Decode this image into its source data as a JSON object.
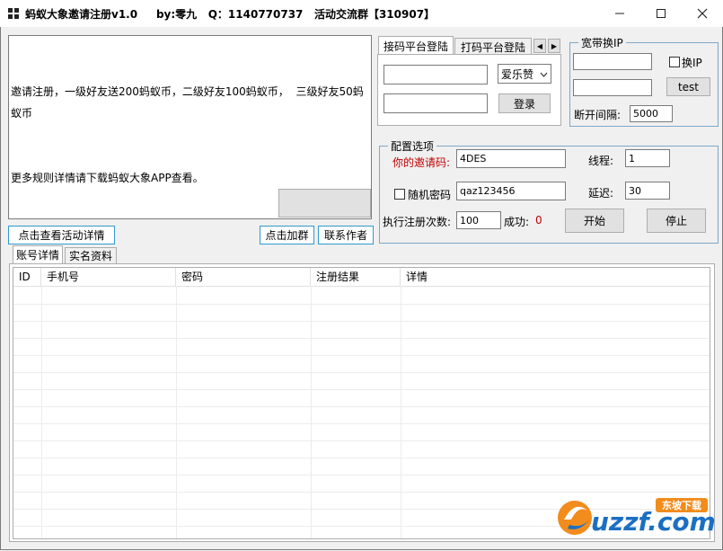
{
  "window": {
    "title": "蚂蚁大象邀请注册v1.0     by:零九   Q：1140770737   活动交流群【310907】",
    "min_icon": "minimize-icon",
    "max_icon": "maximize-icon",
    "close_icon": "close-icon"
  },
  "notice": {
    "line1": "邀请注册，一级好友送200蚂蚁币，二级好友100蚂蚁币，  三级好友50蚂蚁币",
    "line2": "更多规则详情请下载蚂蚁大象APP查看。"
  },
  "links": {
    "activity_details": "点击查看活动详情",
    "join_group": "点击加群",
    "contact_author": "联系作者"
  },
  "platform_tabs": {
    "tab1": "接码平台登陆",
    "tab2": "打码平台登陆",
    "platform_selected": "爱乐赞",
    "login_button": "登录",
    "input1_value": "",
    "input2_value": ""
  },
  "broadband": {
    "group_title": "宽带换IP",
    "input1_value": "",
    "input2_value": "",
    "switch_ip_label": "换IP",
    "test_button": "test",
    "interval_label": "断开间隔:",
    "interval_value": "5000"
  },
  "config": {
    "group_title": "配置选项",
    "invite_label": "你的邀请码:",
    "invite_value": "4DES",
    "threads_label": "线程:",
    "threads_value": "1",
    "random_pwd_label": "随机密码",
    "password_value": "qaz123456",
    "delay_label": "延迟:",
    "delay_value": "30",
    "exec_label": "执行注册次数:",
    "exec_value": "100",
    "success_label": "成功:",
    "success_value": "0",
    "start_button": "开始",
    "stop_button": "停止",
    "invite_label_color": "#c00000",
    "success_value_color": "#c00000"
  },
  "bottom_tabs": {
    "tab1": "账号详情",
    "tab2": "实名资料"
  },
  "table": {
    "columns": [
      "ID",
      "手机号",
      "密码",
      "注册结果",
      "详情"
    ]
  },
  "watermark": {
    "brand": "uzzf.com",
    "badge": "东坡下载"
  }
}
